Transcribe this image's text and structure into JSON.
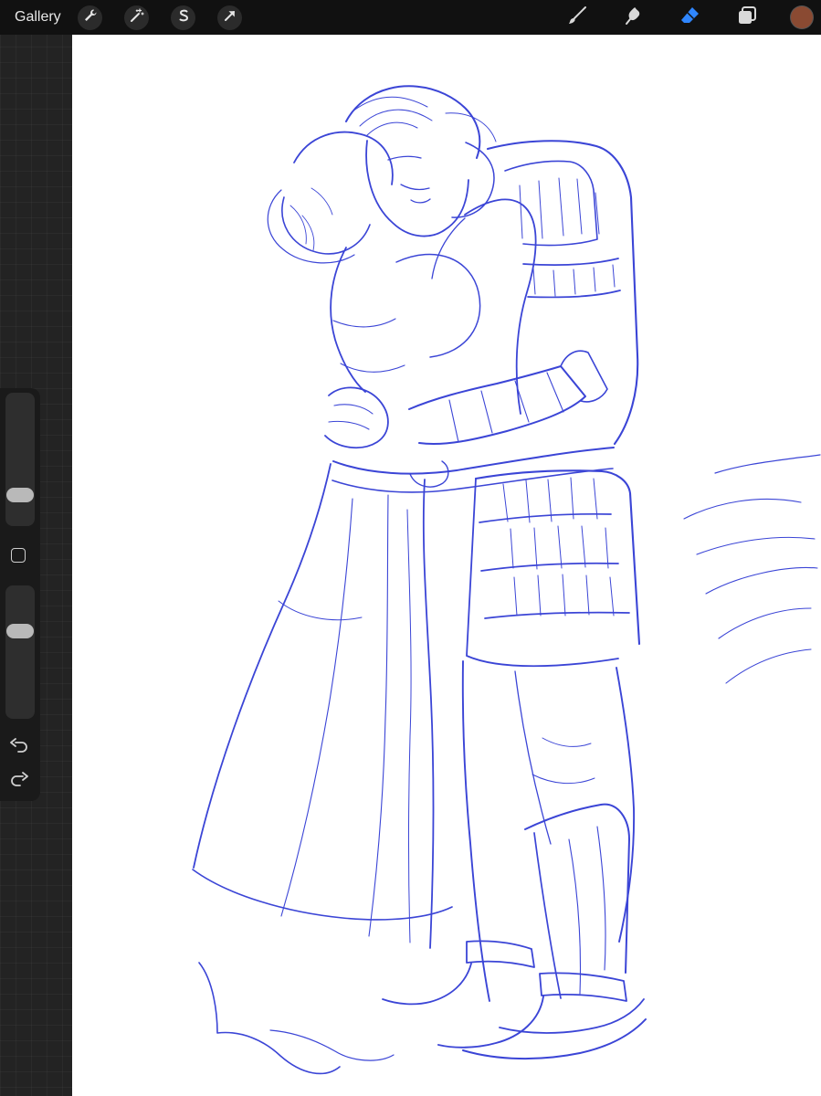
{
  "topbar": {
    "gallery_label": "Gallery",
    "left_tools": [
      {
        "icon": "wrench-icon",
        "name": "actions"
      },
      {
        "icon": "magic-wand-icon",
        "name": "adjustments"
      },
      {
        "icon": "selection-s-icon",
        "name": "selection"
      },
      {
        "icon": "arrow-cursor-icon",
        "name": "transform"
      }
    ],
    "right_tools": [
      {
        "icon": "brush-icon",
        "name": "paint"
      },
      {
        "icon": "smudge-icon",
        "name": "smudge"
      },
      {
        "icon": "eraser-icon",
        "name": "erase",
        "active": true
      },
      {
        "icon": "layers-icon",
        "name": "layers"
      }
    ],
    "current_color": "#8a4a32"
  },
  "sidebar": {
    "brush_size_level": 0.7,
    "opacity_level": 0.5,
    "icons": [
      "modify-square-icon",
      "undo-icon",
      "redo-icon"
    ]
  },
  "canvas": {
    "stroke_color": "#3b45d6",
    "background_color": "#ffffff"
  },
  "colors": {
    "active_tool": "#2f86ff",
    "toolbar": "#111111",
    "inactive_icon": "#d9d9d9"
  }
}
